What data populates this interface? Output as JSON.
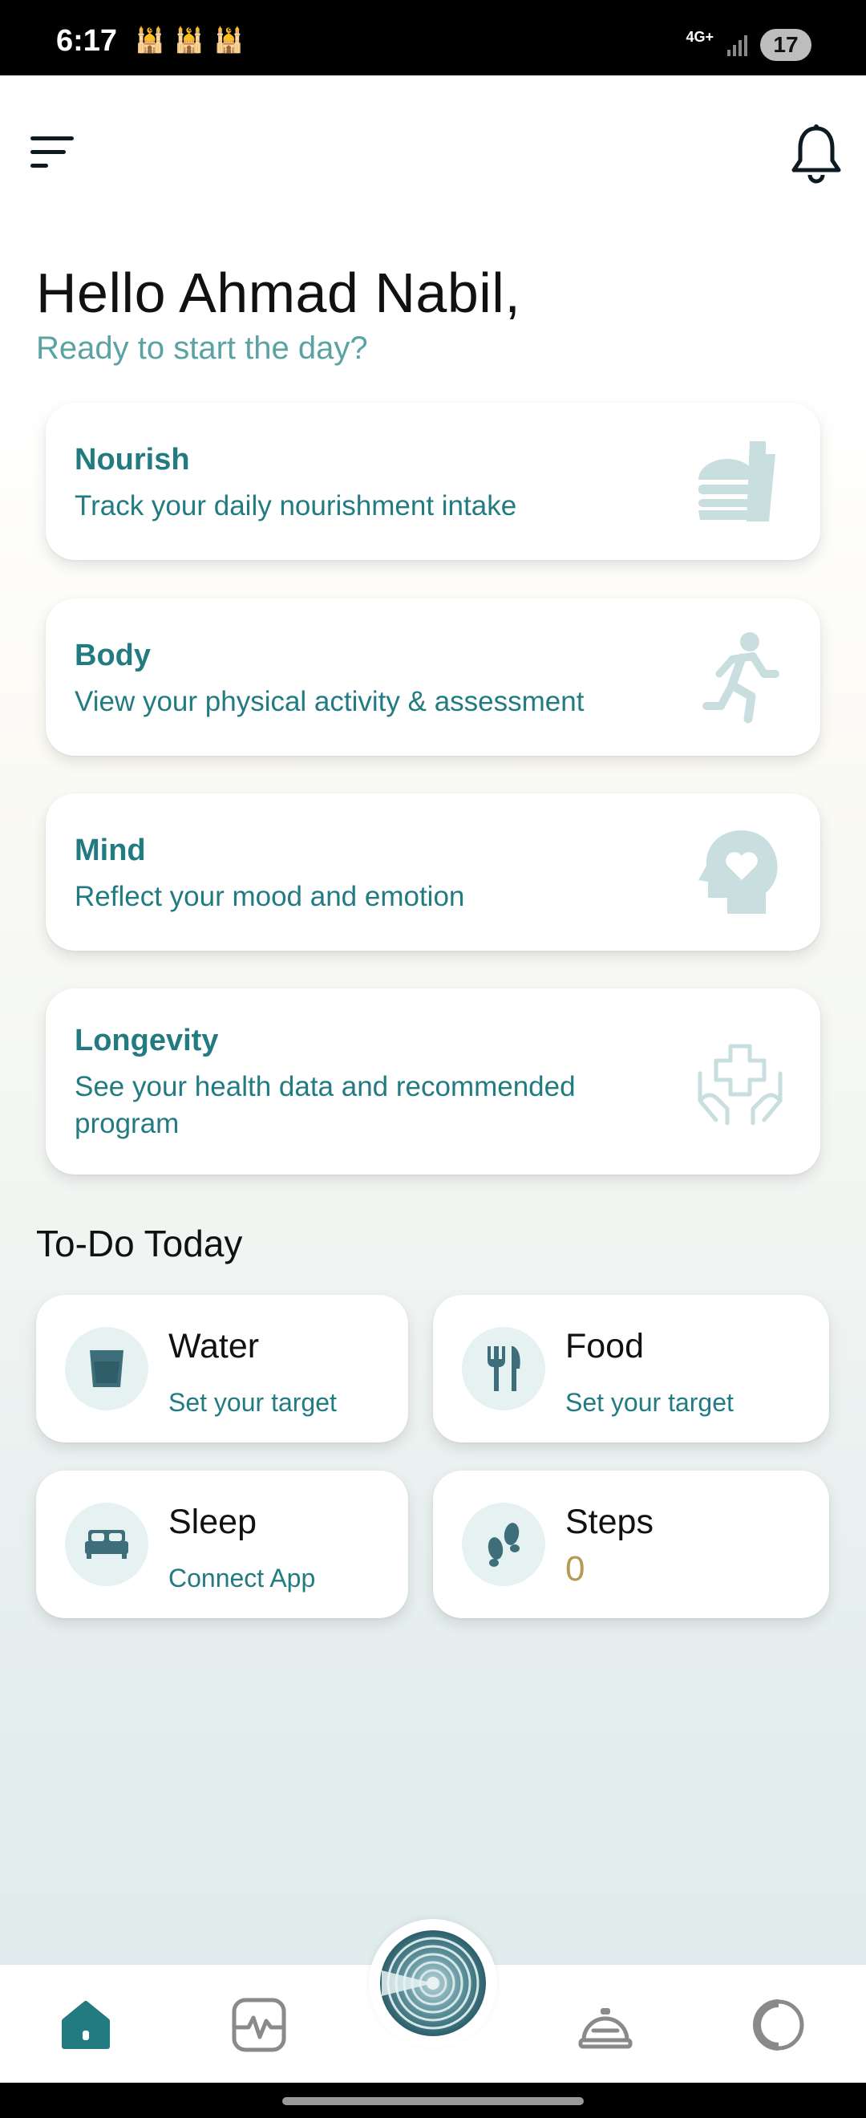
{
  "status_bar": {
    "time": "6:17",
    "network": "4G+",
    "battery": "17",
    "notification_icons": [
      "mosque-icon",
      "mosque-icon",
      "mosque-icon"
    ]
  },
  "header": {
    "menu_icon": "menu-icon",
    "notification_icon": "bell-icon"
  },
  "greeting": {
    "title": "Hello Ahmad Nabil,",
    "subtitle": "Ready to start the day?"
  },
  "categories": [
    {
      "title": "Nourish",
      "description": "Track your daily nourishment intake",
      "icon": "burger-drink-icon"
    },
    {
      "title": "Body",
      "description": "View your physical activity & assessment",
      "icon": "running-person-icon"
    },
    {
      "title": "Mind",
      "description": "Reflect your mood and emotion",
      "icon": "head-heart-icon"
    },
    {
      "title": "Longevity",
      "description": "See your health data and recommended program",
      "icon": "hands-medical-cross-icon"
    }
  ],
  "todo": {
    "heading": "To-Do Today",
    "items": [
      {
        "title": "Water",
        "subtitle": "Set your target",
        "icon": "cup-icon"
      },
      {
        "title": "Food",
        "subtitle": "Set your target",
        "icon": "fork-knife-icon"
      },
      {
        "title": "Sleep",
        "subtitle": "Connect App",
        "icon": "bed-icon"
      },
      {
        "title": "Steps",
        "value": "0",
        "icon": "footprints-icon"
      }
    ]
  },
  "bottom_nav": {
    "items": [
      "home-icon",
      "activity-pulse-icon",
      "center-ring-icon",
      "service-bell-icon",
      "mood-circle-icon"
    ],
    "active": "home-icon"
  },
  "colors": {
    "accent": "#237b82",
    "subtitle": "#5ba2a3",
    "icon_light": "#c9dedf",
    "steps_value": "#b39a55"
  }
}
